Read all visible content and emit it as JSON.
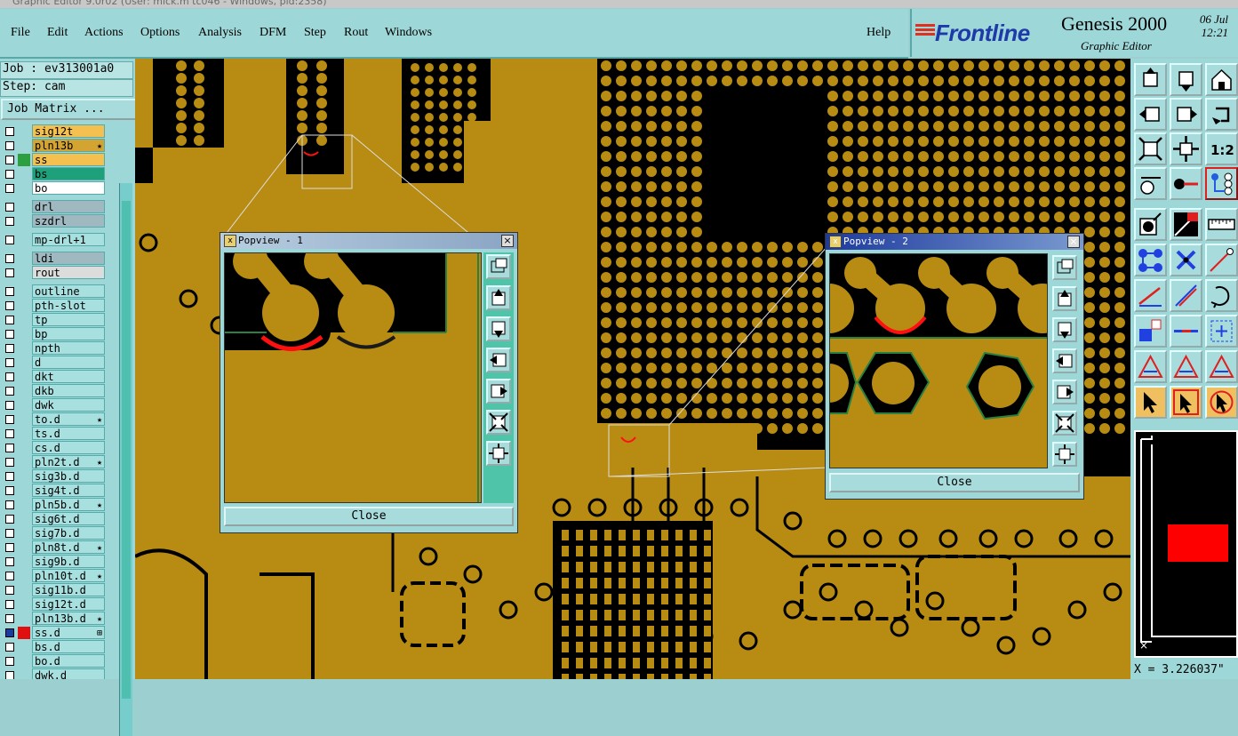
{
  "window": {
    "title": "Graphic Editor 9.0r02 (User: mick.m tc046 - Windows, pid:2358)"
  },
  "menu": {
    "items": [
      "File",
      "Edit",
      "Actions",
      "Options",
      "Analysis",
      "DFM",
      "Step",
      "Rout",
      "Windows"
    ],
    "help": "Help"
  },
  "brand": {
    "logo": "Frontline",
    "product": "Genesis 2000",
    "subtitle": "Graphic Editor",
    "date": "06 Jul",
    "time": "12:21"
  },
  "job": {
    "job_label": "Job : ev313001a0",
    "step_label": "Step: cam",
    "matrix_button": "Job Matrix ..."
  },
  "layers": [
    {
      "name": "sig12t",
      "color": "#f4c050",
      "aff": "none",
      "mark": ""
    },
    {
      "name": "pln13b",
      "color": "#d4a432",
      "aff": "none",
      "mark": "★"
    },
    {
      "name": "ss",
      "color": "#f4c050",
      "aff": "#2ca040",
      "mark": ""
    },
    {
      "name": "bs",
      "color": "#1ea07a",
      "aff": "none",
      "mark": ""
    },
    {
      "name": "bo",
      "color": "#ffffff",
      "aff": "none",
      "mark": ""
    },
    {
      "name": "drl",
      "color": "#a0b8c0",
      "aff": "none",
      "mark": "",
      "gap": true
    },
    {
      "name": "szdrl",
      "color": "#a0b8c0",
      "aff": "none",
      "mark": ""
    },
    {
      "name": "mp-drl+1",
      "color": "#a8e0e0",
      "aff": "none",
      "mark": "",
      "gap": true
    },
    {
      "name": "ldi",
      "color": "#a0b8c0",
      "aff": "none",
      "mark": "",
      "gap": true
    },
    {
      "name": "rout",
      "color": "#dcdcdc",
      "aff": "none",
      "mark": ""
    },
    {
      "name": "outline",
      "color": "#a8e0e0",
      "aff": "none",
      "mark": "",
      "gap": true
    },
    {
      "name": "pth-slot",
      "color": "#a8e0e0",
      "aff": "none",
      "mark": ""
    },
    {
      "name": "tp",
      "color": "#a8e0e0",
      "aff": "none",
      "mark": ""
    },
    {
      "name": "bp",
      "color": "#a8e0e0",
      "aff": "none",
      "mark": ""
    },
    {
      "name": "npth",
      "color": "#a8e0e0",
      "aff": "none",
      "mark": ""
    },
    {
      "name": "d",
      "color": "#a8e0e0",
      "aff": "none",
      "mark": ""
    },
    {
      "name": "dkt",
      "color": "#a8e0e0",
      "aff": "none",
      "mark": ""
    },
    {
      "name": "dkb",
      "color": "#a8e0e0",
      "aff": "none",
      "mark": ""
    },
    {
      "name": "dwk",
      "color": "#a8e0e0",
      "aff": "none",
      "mark": ""
    },
    {
      "name": "to.d",
      "color": "#a8e0e0",
      "aff": "none",
      "mark": "★"
    },
    {
      "name": "ts.d",
      "color": "#a8e0e0",
      "aff": "none",
      "mark": ""
    },
    {
      "name": "cs.d",
      "color": "#a8e0e0",
      "aff": "none",
      "mark": ""
    },
    {
      "name": "pln2t.d",
      "color": "#a8e0e0",
      "aff": "none",
      "mark": "★"
    },
    {
      "name": "sig3b.d",
      "color": "#a8e0e0",
      "aff": "none",
      "mark": ""
    },
    {
      "name": "sig4t.d",
      "color": "#a8e0e0",
      "aff": "none",
      "mark": ""
    },
    {
      "name": "pln5b.d",
      "color": "#a8e0e0",
      "aff": "none",
      "mark": "★"
    },
    {
      "name": "sig6t.d",
      "color": "#a8e0e0",
      "aff": "none",
      "mark": ""
    },
    {
      "name": "sig7b.d",
      "color": "#a8e0e0",
      "aff": "none",
      "mark": ""
    },
    {
      "name": "pln8t.d",
      "color": "#a8e0e0",
      "aff": "none",
      "mark": "★"
    },
    {
      "name": "sig9b.d",
      "color": "#a8e0e0",
      "aff": "none",
      "mark": ""
    },
    {
      "name": "pln10t.d",
      "color": "#a8e0e0",
      "aff": "none",
      "mark": "★"
    },
    {
      "name": "sig11b.d",
      "color": "#a8e0e0",
      "aff": "none",
      "mark": ""
    },
    {
      "name": "sig12t.d",
      "color": "#a8e0e0",
      "aff": "none",
      "mark": ""
    },
    {
      "name": "pln13b.d",
      "color": "#a8e0e0",
      "aff": "none",
      "mark": "★"
    },
    {
      "name": "ss.d",
      "color": "#a8e0e0",
      "aff": "#e01010",
      "mark": "⊞"
    },
    {
      "name": "bs.d",
      "color": "#a8e0e0",
      "aff": "none",
      "mark": ""
    },
    {
      "name": "bo.d",
      "color": "#a8e0e0",
      "aff": "none",
      "mark": ""
    },
    {
      "name": "dwk.d",
      "color": "#a8e0e0",
      "aff": "none",
      "mark": ""
    }
  ],
  "popview1": {
    "title": "Popview - 1",
    "close": "Close"
  },
  "popview2": {
    "title": "Popview - 2",
    "close": "Close"
  },
  "status": {
    "coord": "X = 3.226037\""
  },
  "colors": {
    "copper": "#b88c12",
    "background": "#000000",
    "highlight": "#ff1010",
    "panel": "#9ed7d8"
  }
}
